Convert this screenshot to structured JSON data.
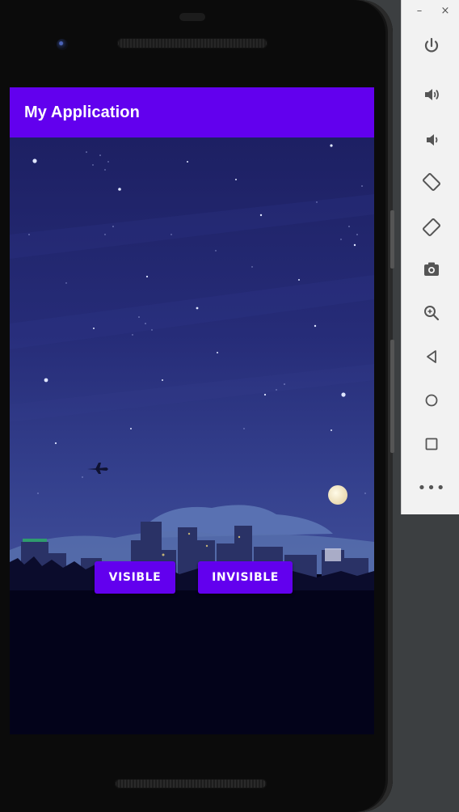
{
  "app": {
    "title": "My Application"
  },
  "buttons": {
    "visible_label": "VISIBLE",
    "invisible_label": "INVISIBLE"
  },
  "window": {
    "minimize_glyph": "–",
    "close_glyph": "×"
  },
  "toolbar": {
    "more_glyph": "•••",
    "items": [
      {
        "name": "power-icon"
      },
      {
        "name": "volume-up-icon"
      },
      {
        "name": "volume-down-icon"
      },
      {
        "name": "rotate-left-icon"
      },
      {
        "name": "rotate-right-icon"
      },
      {
        "name": "camera-icon"
      },
      {
        "name": "zoom-icon"
      },
      {
        "name": "back-icon"
      },
      {
        "name": "home-icon"
      },
      {
        "name": "overview-icon"
      },
      {
        "name": "more-icon"
      }
    ]
  },
  "colors": {
    "app_bar": "#6200ee",
    "button": "#6200ee",
    "sky_top": "#1e2263",
    "sky_bottom": "#3c4a95",
    "ground": "#03031a",
    "toolbar_bg": "#f2f2f2",
    "toolbar_icon": "#555555"
  }
}
